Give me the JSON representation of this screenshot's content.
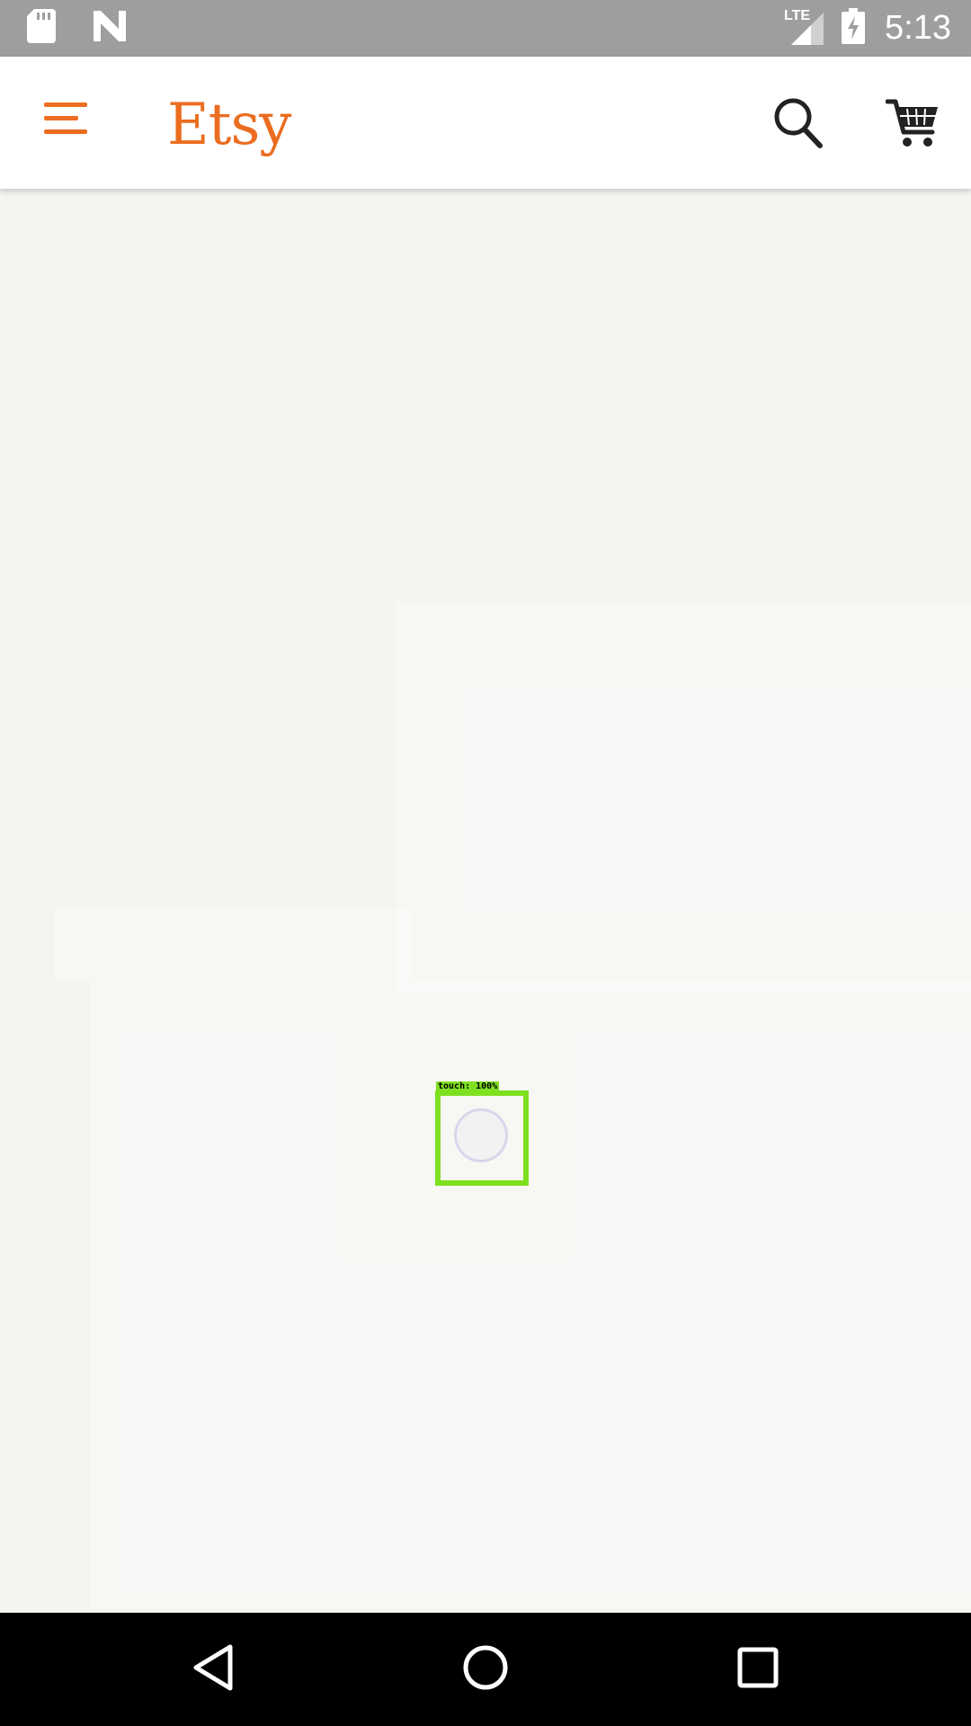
{
  "status_bar": {
    "time": "5:13",
    "network": "LTE",
    "icons": [
      "sd-card-icon",
      "n-notification-icon",
      "lte-signal-icon",
      "battery-charging-icon"
    ]
  },
  "app_bar": {
    "brand": "Etsy",
    "brand_color": "#eb6d20",
    "icons": [
      "menu-icon",
      "search-icon",
      "cart-icon"
    ]
  },
  "content": {
    "state": "loading"
  },
  "overlay": {
    "touch_label": "touch: 100%",
    "color": "#7ee01f"
  },
  "nav_bar": {
    "icons": [
      "back-icon",
      "home-icon",
      "recents-icon"
    ]
  }
}
